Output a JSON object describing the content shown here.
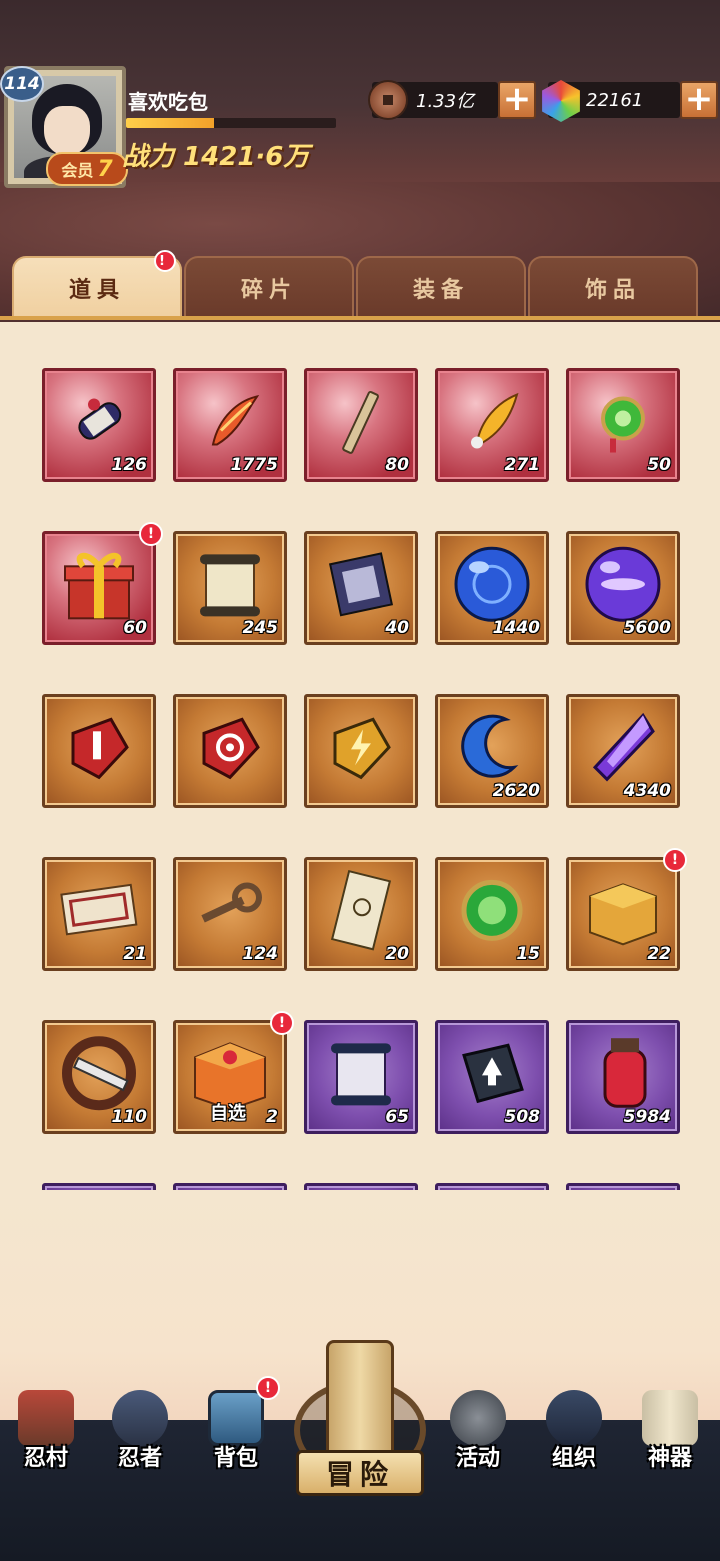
{
  "player": {
    "level": "114",
    "name": "喜欢吃包",
    "vip_label": "会员",
    "vip_level": "7",
    "power": "战力 1421·6万",
    "exp_progress": 0.42
  },
  "resources": {
    "coins": "1.33亿",
    "gems": "22161",
    "plus": "+"
  },
  "tabs": [
    {
      "label": "道具",
      "active": true,
      "alert": "!"
    },
    {
      "label": "碎片",
      "active": false
    },
    {
      "label": "装备",
      "active": false
    },
    {
      "label": "饰品",
      "active": false
    }
  ],
  "items": [
    {
      "icon": "scroll-bundle-icon",
      "count": "126",
      "rarity": "red"
    },
    {
      "icon": "feather-icon",
      "count": "1775",
      "rarity": "red"
    },
    {
      "icon": "paper-strip-icon",
      "count": "80",
      "rarity": "red"
    },
    {
      "icon": "golden-feather-icon",
      "count": "271",
      "rarity": "red"
    },
    {
      "icon": "green-jade-icon",
      "count": "50",
      "rarity": "red"
    },
    {
      "icon": "gift-box-icon",
      "count": "60",
      "rarity": "red",
      "alert": "!"
    },
    {
      "icon": "scroll-icon",
      "count": "245",
      "rarity": "orange"
    },
    {
      "icon": "exchange-tag-icon",
      "count": "40",
      "rarity": "orange"
    },
    {
      "icon": "blue-orb-icon",
      "count": "1440",
      "rarity": "orange"
    },
    {
      "icon": "purple-orb-icon",
      "count": "5600",
      "rarity": "orange"
    },
    {
      "icon": "red-stone-broom-icon",
      "count": "",
      "rarity": "orange"
    },
    {
      "icon": "red-stone-target-icon",
      "count": "",
      "rarity": "orange"
    },
    {
      "icon": "gold-stone-lightning-icon",
      "count": "",
      "rarity": "orange"
    },
    {
      "icon": "blue-moon-icon",
      "count": "2620",
      "rarity": "orange"
    },
    {
      "icon": "purple-crystal-icon",
      "count": "4340",
      "rarity": "orange"
    },
    {
      "icon": "lucky-ticket-icon",
      "count": "21",
      "rarity": "orange"
    },
    {
      "icon": "key-icon",
      "count": "124",
      "rarity": "orange"
    },
    {
      "icon": "seal-paper-icon",
      "count": "20",
      "rarity": "orange"
    },
    {
      "icon": "green-heart-medal-icon",
      "count": "15",
      "rarity": "orange"
    },
    {
      "icon": "gold-box-icon",
      "count": "22",
      "rarity": "orange",
      "alert": "!"
    },
    {
      "icon": "kunai-swirl-icon",
      "count": "110",
      "rarity": "orange"
    },
    {
      "icon": "select-chest-icon",
      "count": "2",
      "rarity": "orange",
      "alert": "!",
      "label": "自选"
    },
    {
      "icon": "scroll-purple-icon",
      "count": "65",
      "rarity": "purple"
    },
    {
      "icon": "upgrade-book-icon",
      "count": "508",
      "rarity": "purple"
    },
    {
      "icon": "potion-jar-icon",
      "count": "5984",
      "rarity": "purple"
    },
    {
      "icon": "",
      "count": "",
      "rarity": "purple"
    },
    {
      "icon": "",
      "count": "",
      "rarity": "purple"
    },
    {
      "icon": "",
      "count": "",
      "rarity": "purple"
    },
    {
      "icon": "",
      "count": "",
      "rarity": "purple"
    },
    {
      "icon": "",
      "count": "",
      "rarity": "purple"
    }
  ],
  "nav": [
    {
      "label": "忍村",
      "icon": "village-gate-icon"
    },
    {
      "label": "忍者",
      "icon": "ninja-head-icon"
    },
    {
      "label": "背包",
      "icon": "backpack-icon",
      "alert": "!"
    },
    {
      "label": "活动",
      "icon": "crossed-kunai-icon"
    },
    {
      "label": "组织",
      "icon": "organization-icon"
    },
    {
      "label": "神器",
      "icon": "artifact-scroll-icon"
    }
  ],
  "adventure": {
    "label": "冒险",
    "icon": "adventure-scroll-icon"
  },
  "colors": {
    "red_slot": "#b0303f",
    "orange_slot": "#c47a34",
    "purple_slot": "#7e4fae",
    "alert": "#e8283a",
    "tab_active": "#f0d0a0"
  }
}
